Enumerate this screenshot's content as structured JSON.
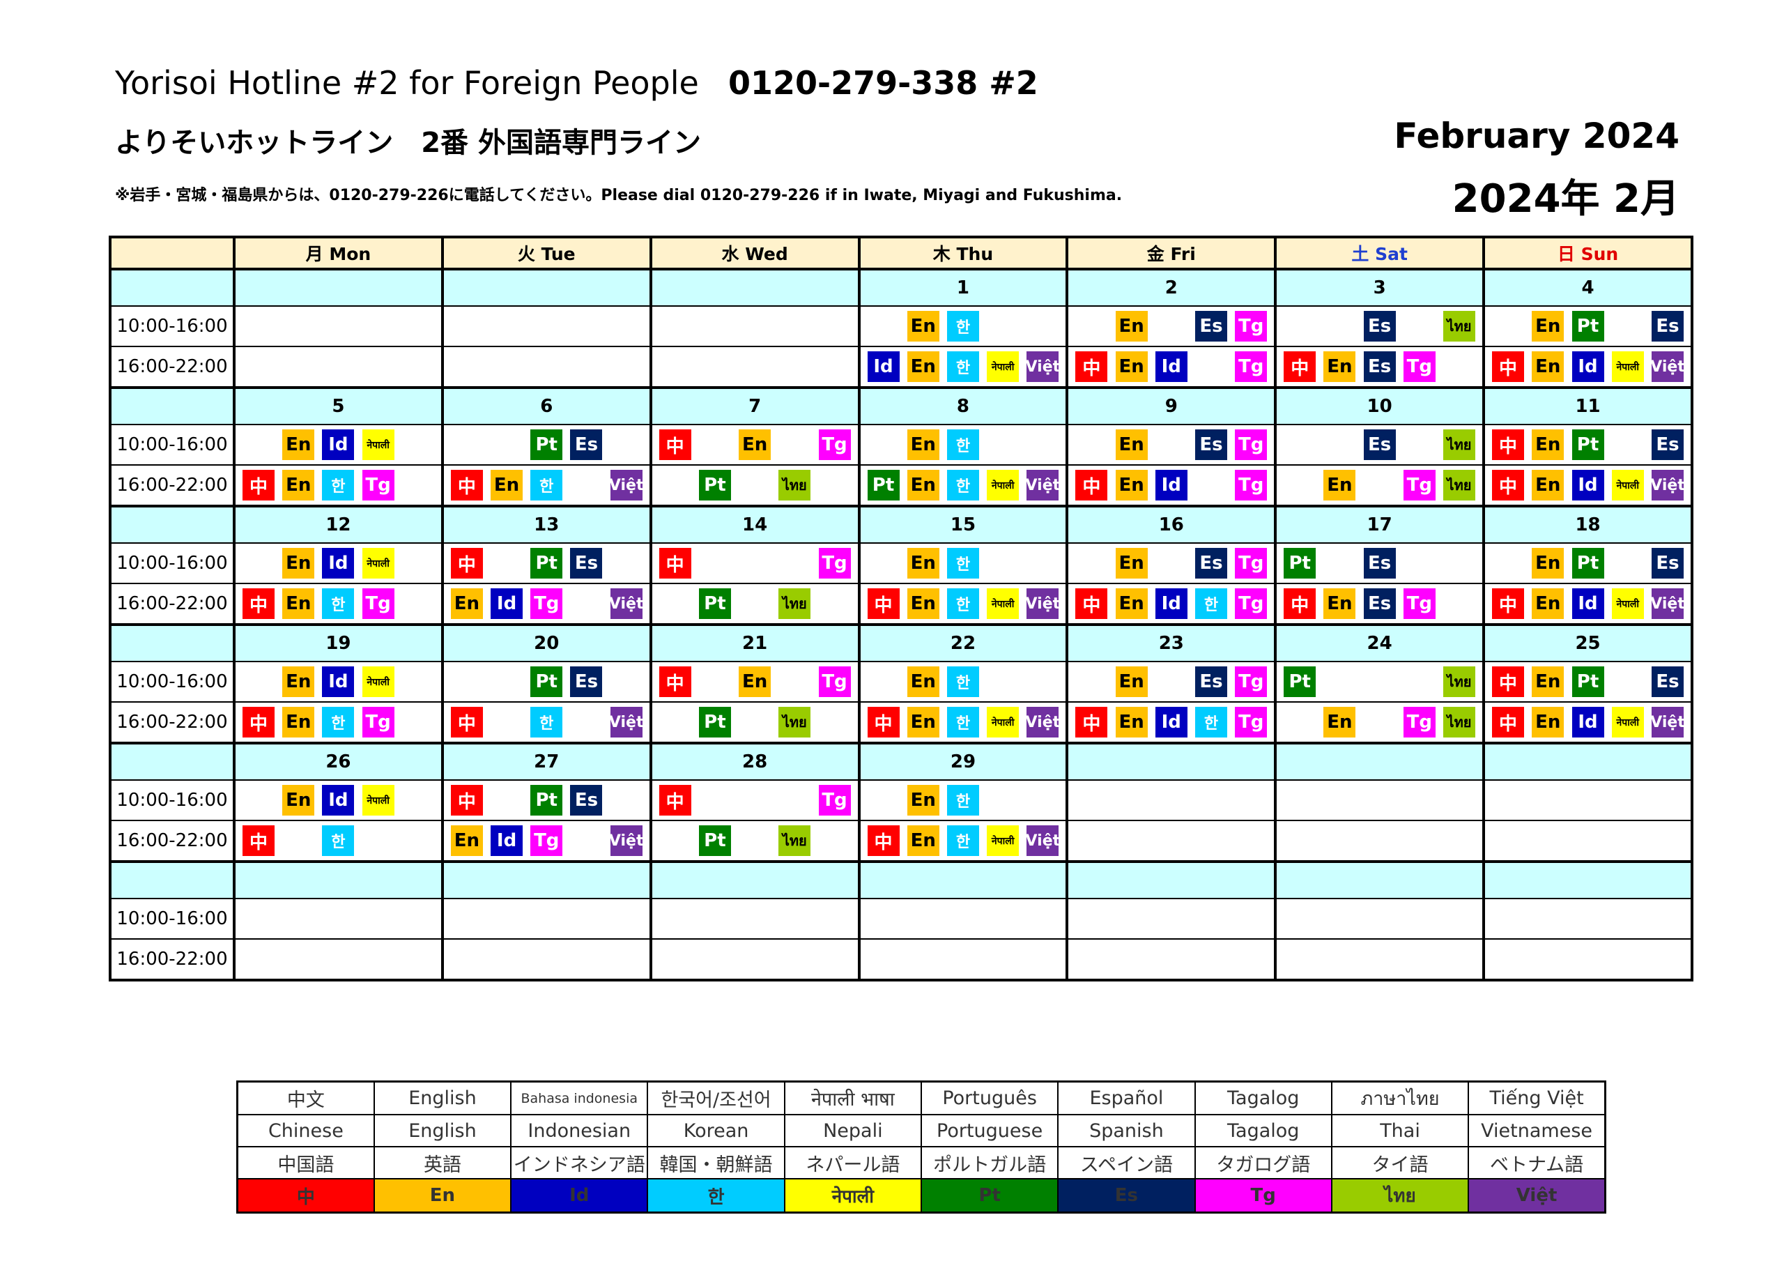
{
  "header": {
    "title_en": "Yorisoi Hotline #2 for Foreign People",
    "phone": "0120-279-338 #2",
    "title_jp": "よりそいホットライン　2番 外国語専門ライン",
    "note": "※岩手・宮城・福島県からは、0120-279-226に電話してください。Please dial 0120-279-226 if in Iwate, Miyagi and Fukushima.",
    "month_en": "February  2024",
    "month_jp": "2024年 2月"
  },
  "calendar": {
    "day_headers": [
      "月 Mon",
      "火 Tue",
      "水 Wed",
      "木 Thu",
      "金 Fri",
      "土 Sat",
      "日 Sun"
    ],
    "time_slots": [
      "10:00-16:00",
      "16:00-22:00"
    ],
    "weeks": [
      {
        "dates": [
          "",
          "",
          "",
          "1",
          "2",
          "3",
          "4"
        ],
        "am": [
          [],
          [],
          [],
          [
            "",
            "en",
            "ko",
            "",
            ""
          ],
          [
            "",
            "en",
            "",
            "es",
            "tg"
          ],
          [
            "",
            "",
            "es",
            "",
            "th"
          ],
          [
            "",
            "en",
            "pt",
            "",
            "es"
          ]
        ],
        "pm": [
          [],
          [],
          [],
          [
            "id",
            "en",
            "ko",
            "ne",
            "vi"
          ],
          [
            "zh",
            "en",
            "id",
            "",
            "tg"
          ],
          [
            "zh",
            "en",
            "es",
            "tg",
            ""
          ],
          [
            "zh",
            "en",
            "id",
            "ne",
            "vi"
          ]
        ]
      },
      {
        "dates": [
          "5",
          "6",
          "7",
          "8",
          "9",
          "10",
          "11"
        ],
        "am": [
          [
            "",
            "en",
            "id",
            "ne",
            ""
          ],
          [
            "",
            "",
            "pt",
            "es",
            ""
          ],
          [
            "zh",
            "",
            "en",
            "",
            "tg"
          ],
          [
            "",
            "en",
            "ko",
            "",
            ""
          ],
          [
            "",
            "en",
            "",
            "es",
            "tg"
          ],
          [
            "",
            "",
            "es",
            "",
            "th"
          ],
          [
            "zh",
            "en",
            "pt",
            "",
            "es"
          ]
        ],
        "pm": [
          [
            "zh",
            "en",
            "ko",
            "tg",
            ""
          ],
          [
            "zh",
            "en",
            "ko",
            "",
            "vi"
          ],
          [
            "",
            "pt",
            "",
            "th",
            ""
          ],
          [
            "pt",
            "en",
            "ko",
            "ne",
            "vi"
          ],
          [
            "zh",
            "en",
            "id",
            "",
            "tg"
          ],
          [
            "",
            "en",
            "",
            "tg",
            "th"
          ],
          [
            "zh",
            "en",
            "id",
            "ne",
            "vi"
          ]
        ]
      },
      {
        "dates": [
          "12",
          "13",
          "14",
          "15",
          "16",
          "17",
          "18"
        ],
        "am": [
          [
            "",
            "en",
            "id",
            "ne",
            ""
          ],
          [
            "zh",
            "",
            "pt",
            "es",
            ""
          ],
          [
            "zh",
            "",
            "",
            "",
            "tg"
          ],
          [
            "",
            "en",
            "ko",
            "",
            ""
          ],
          [
            "",
            "en",
            "",
            "es",
            "tg"
          ],
          [
            "pt",
            "",
            "es",
            "",
            ""
          ],
          [
            "",
            "en",
            "pt",
            "",
            "es"
          ]
        ],
        "pm": [
          [
            "zh",
            "en",
            "ko",
            "tg",
            ""
          ],
          [
            "en",
            "id",
            "tg",
            "",
            "vi"
          ],
          [
            "",
            "pt",
            "",
            "th",
            ""
          ],
          [
            "zh",
            "en",
            "ko",
            "ne",
            "vi"
          ],
          [
            "zh",
            "en",
            "id",
            "ko",
            "tg"
          ],
          [
            "zh",
            "en",
            "es",
            "tg",
            ""
          ],
          [
            "zh",
            "en",
            "id",
            "ne",
            "vi"
          ]
        ]
      },
      {
        "dates": [
          "19",
          "20",
          "21",
          "22",
          "23",
          "24",
          "25"
        ],
        "am": [
          [
            "",
            "en",
            "id",
            "ne",
            ""
          ],
          [
            "",
            "",
            "pt",
            "es",
            ""
          ],
          [
            "zh",
            "",
            "en",
            "",
            "tg"
          ],
          [
            "",
            "en",
            "ko",
            "",
            ""
          ],
          [
            "",
            "en",
            "",
            "es",
            "tg"
          ],
          [
            "pt",
            "",
            "",
            "",
            "th"
          ],
          [
            "zh",
            "en",
            "pt",
            "",
            "es"
          ]
        ],
        "pm": [
          [
            "zh",
            "en",
            "ko",
            "tg",
            ""
          ],
          [
            "zh",
            "",
            "ko",
            "",
            "vi"
          ],
          [
            "",
            "pt",
            "",
            "th",
            ""
          ],
          [
            "zh",
            "en",
            "ko",
            "ne",
            "vi"
          ],
          [
            "zh",
            "en",
            "id",
            "ko",
            "tg"
          ],
          [
            "",
            "en",
            "",
            "tg",
            "th"
          ],
          [
            "zh",
            "en",
            "id",
            "ne",
            "vi"
          ]
        ]
      },
      {
        "dates": [
          "26",
          "27",
          "28",
          "29",
          "",
          "",
          ""
        ],
        "am": [
          [
            "",
            "en",
            "id",
            "ne",
            ""
          ],
          [
            "zh",
            "",
            "pt",
            "es",
            ""
          ],
          [
            "zh",
            "",
            "",
            "",
            "tg"
          ],
          [
            "",
            "en",
            "ko",
            "",
            ""
          ],
          [],
          [],
          []
        ],
        "pm": [
          [
            "zh",
            "",
            "ko",
            "",
            ""
          ],
          [
            "en",
            "id",
            "tg",
            "",
            "vi"
          ],
          [
            "",
            "pt",
            "",
            "th",
            ""
          ],
          [
            "zh",
            "en",
            "ko",
            "ne",
            "vi"
          ],
          [],
          [],
          []
        ]
      },
      {
        "dates": [
          "",
          "",
          "",
          "",
          "",
          "",
          ""
        ],
        "am": [
          [],
          [],
          [],
          [],
          [],
          [],
          []
        ],
        "pm": [
          [],
          [],
          [],
          [],
          [],
          [],
          []
        ]
      }
    ]
  },
  "languages": {
    "zh": {
      "chip": "中",
      "native": "中文",
      "english": "Chinese",
      "japanese": "中国語",
      "color": "#ff0000"
    },
    "en": {
      "chip": "En",
      "native": "English",
      "english": "English",
      "japanese": "英語",
      "color": "#ffc000"
    },
    "id": {
      "chip": "Id",
      "native": "Bahasa indonesia",
      "english": "Indonesian",
      "japanese": "インドネシア語",
      "color": "#0000c0"
    },
    "ko": {
      "chip": "한",
      "native": "한국어/조선어",
      "english": "Korean",
      "japanese": "韓国・朝鮮語",
      "color": "#00ccff"
    },
    "ne": {
      "chip": "नेपाली",
      "native": "नेपाली भाषा",
      "english": "Nepali",
      "japanese": "ネパール語",
      "color": "#ffff00"
    },
    "pt": {
      "chip": "Pt",
      "native": "Português",
      "english": "Portuguese",
      "japanese": "ポルトガル語",
      "color": "#008000"
    },
    "es": {
      "chip": "Es",
      "native": "Español",
      "english": "Spanish",
      "japanese": "スペイン語",
      "color": "#002060"
    },
    "tg": {
      "chip": "Tg",
      "native": "Tagalog",
      "english": "Tagalog",
      "japanese": "タガログ語",
      "color": "#ff00ff"
    },
    "th": {
      "chip": "ไทย",
      "native": "ภาษาไทย",
      "english": "Thai",
      "japanese": "タイ語",
      "color": "#99cc00"
    },
    "vi": {
      "chip": "Việt",
      "native": "Tiếng Việt",
      "english": "Vietnamese",
      "japanese": "ベトナム語",
      "color": "#7030a0"
    }
  },
  "legend_order": [
    "zh",
    "en",
    "id",
    "ko",
    "ne",
    "pt",
    "es",
    "tg",
    "th",
    "vi"
  ]
}
